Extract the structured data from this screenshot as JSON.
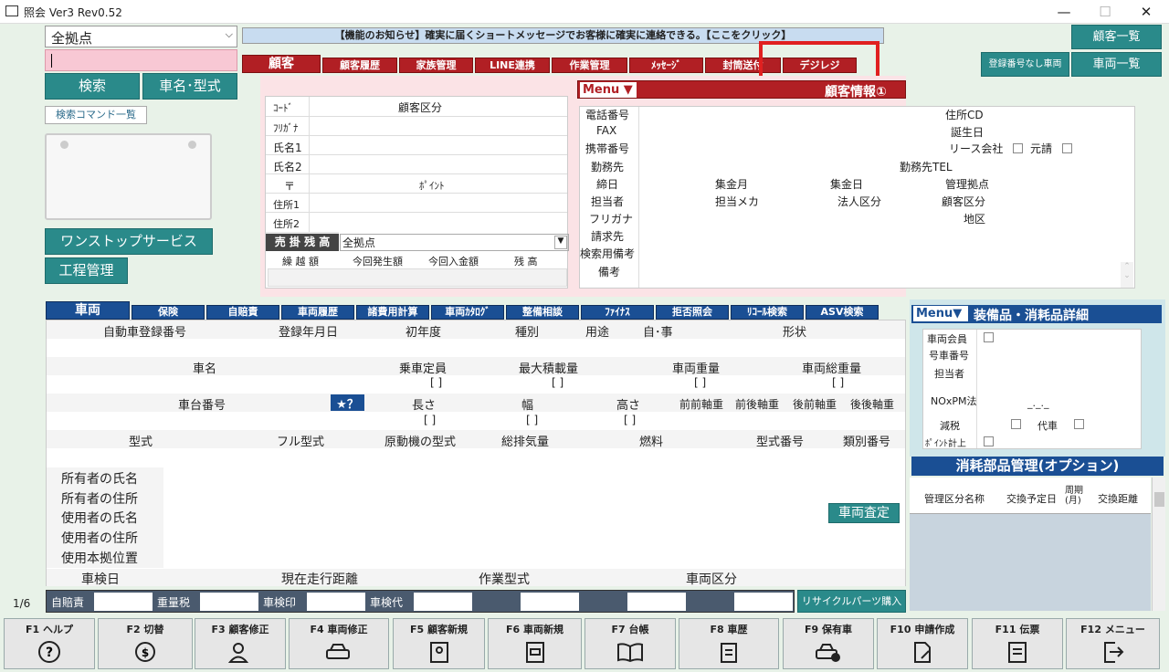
{
  "window": {
    "title": "照会 Ver3 Rev0.52",
    "minimize": "—",
    "maximize": "☐",
    "close": "✕"
  },
  "left": {
    "location": "全拠点",
    "search": "検索",
    "carname": "車名･型式",
    "cmdlist": "検索コマンド一覧",
    "onestop": "ワンストップサービス",
    "process": "工程管理",
    "page": "1/6"
  },
  "notice": "【機能のお知らせ】確実に届くショートメッセージでお客様に確実に連絡できる。【ここをクリック】",
  "right_buttons": {
    "customers": "顧客一覧",
    "no_reg": "登録番号なし車両",
    "vehicles": "車両一覧"
  },
  "customer_tabs": [
    "顧客",
    "顧客履歴",
    "家族管理",
    "LINE連携",
    "作業管理",
    "ﾒｯｾｰｼﾞ",
    "封筒送付",
    "デジレジ"
  ],
  "cust_form": {
    "code": "ｺｰﾄﾞ",
    "kubun": "顧客区分",
    "kana": "ﾌﾘｶﾞﾅ",
    "name1": "氏名1",
    "name2": "氏名2",
    "zip": "〒",
    "point": "ﾎﾟｲﾝﾄ",
    "addr1": "住所1",
    "addr2": "住所2",
    "ar_label": "売 掛 残 高",
    "ar_location": "全拠点",
    "ar_cols": [
      "繰 越 額",
      "今回発生額",
      "今回入金額",
      "残 高"
    ]
  },
  "cust_info": {
    "menu": "Menu ▼",
    "title": "顧客情報①",
    "tel": "電話番号",
    "fax": "FAX",
    "mobile": "携帯番号",
    "work": "勤務先",
    "close": "締日",
    "staff": "担当者",
    "kana": "フリガナ",
    "billing": "請求先",
    "search_note": "検索用備考",
    "note": "備考",
    "addr_cd": "住所CD",
    "birthday": "誕生日",
    "lease": "リース会社",
    "motouke": "元請",
    "work_tel": "勤務先TEL",
    "collect_month": "集金月",
    "collect_day": "集金日",
    "mgmt_base": "管理拠点",
    "maker": "担当メカ",
    "corp": "法人区分",
    "cust_kubun": "顧客区分",
    "area": "地区"
  },
  "vehicle_tabs": [
    "車両",
    "保険",
    "自賠責",
    "車両履歴",
    "諸費用計算",
    "車両ｶﾀﾛｸﾞ",
    "整備相談",
    "ﾌｧｲﾅｽ",
    "拒否照会",
    "ﾘｺｰﾙ検索",
    "ASV検索"
  ],
  "vehicle": {
    "reg_no": "自動車登録番号",
    "reg_date": "登録年月日",
    "first_year": "初年度",
    "type": "種別",
    "use": "用途",
    "private": "自･事",
    "shape": "形状",
    "name": "車名",
    "capacity": "乗車定員",
    "max_load": "最大積載量",
    "weight": "車両重量",
    "gross": "車両総重量",
    "chassis": "車台番号",
    "star": "★？",
    "length": "長さ",
    "width": "幅",
    "height": "高さ",
    "ff": "前前軸重",
    "fr": "前後軸重",
    "rf": "後前軸重",
    "rr": "後後軸重",
    "model": "型式",
    "full_model": "フル型式",
    "engine": "原動機の型式",
    "cc": "総排気量",
    "fuel": "燃料",
    "model_no": "型式番号",
    "class_no": "類別番号",
    "owner_name": "所有者の氏名",
    "owner_addr": "所有者の住所",
    "user_name": "使用者の氏名",
    "user_addr": "使用者の住所",
    "base": "使用本拠位置",
    "inspection": "車検日",
    "mileage": "現在走行距離",
    "work_type": "作業型式",
    "car_kubun": "車両区分",
    "appraise": "車両査定",
    "bracket": "[          ]"
  },
  "fees": {
    "jibai": "自賠責",
    "weight_tax": "重量税",
    "stamp": "車検印",
    "insp_fee": "車検代",
    "recycle": "リサイクルパーツ購入"
  },
  "equip": {
    "menu": "Menu▼",
    "title": "装備品・消耗品詳細",
    "member": "車両会員",
    "car_no": "号車番号",
    "staff": "担当者",
    "nox": "NOxPM法",
    "tax_red": "減税",
    "daisha": "代車",
    "point": "ﾎﾟｲﾝﾄ計上",
    "nox_val": "_._._",
    "parts_title": "消耗部品管理(オプション)",
    "cols": [
      "管理区分名称",
      "交換予定日",
      "周期(月)",
      "交換距離"
    ]
  },
  "fkeys": [
    {
      "k": "F1 ヘルプ"
    },
    {
      "k": "F2 切替"
    },
    {
      "k": "F3 顧客修正"
    },
    {
      "k": "F4 車両修正"
    },
    {
      "k": "F5 顧客新規"
    },
    {
      "k": "F6 車両新規"
    },
    {
      "k": "F7 台帳"
    },
    {
      "k": "F8 車歴"
    },
    {
      "k": "F9 保有車"
    },
    {
      "k": "F10 申請作成"
    },
    {
      "k": "F11 伝票"
    },
    {
      "k": "F12 メニュー"
    }
  ]
}
